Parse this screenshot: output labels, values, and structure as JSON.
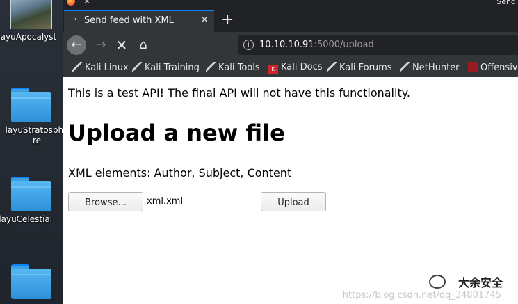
{
  "desktop": {
    "items": [
      {
        "label": "llayuApocalyst"
      },
      {
        "label": "layuStratosphe\nre"
      },
      {
        "label": "dayuCelestial"
      },
      {
        "label": ""
      }
    ]
  },
  "window": {
    "title_right": "Send"
  },
  "tab": {
    "title": "Send feed with XML",
    "close": "✕",
    "new_tab": "+"
  },
  "nav": {
    "back": "←",
    "forward": "→",
    "stop": "✕",
    "home": "⌂"
  },
  "url": {
    "host": "10.10.10.91",
    "path": ":5000/upload"
  },
  "bookmarks": [
    {
      "label": "Kali Linux",
      "icon": "kali-dragon-icon"
    },
    {
      "label": "Kali Training",
      "icon": "kali-dragon-icon"
    },
    {
      "label": "Kali Tools",
      "icon": "kali-dragon-icon"
    },
    {
      "label": "Kali Docs",
      "icon": "kali-docs-icon"
    },
    {
      "label": "Kali Forums",
      "icon": "kali-dragon-icon"
    },
    {
      "label": "NetHunter",
      "icon": "nethunter-icon"
    },
    {
      "label": "Offensive",
      "icon": "offsec-icon"
    }
  ],
  "page": {
    "notice": "This is a test API! The final API will not have this functionality.",
    "heading": "Upload a new file",
    "elements_text": "XML elements: Author, Subject, Content",
    "browse_label": "Browse...",
    "file_name": "xml.xml",
    "upload_label": "Upload"
  },
  "watermark": {
    "url": "https://blog.csdn.net/qq_34801745",
    "badge": "大余安全"
  },
  "colors": {
    "accent_tab": "#0a84ff",
    "chrome_dark": "#202226",
    "chrome": "#323639"
  }
}
